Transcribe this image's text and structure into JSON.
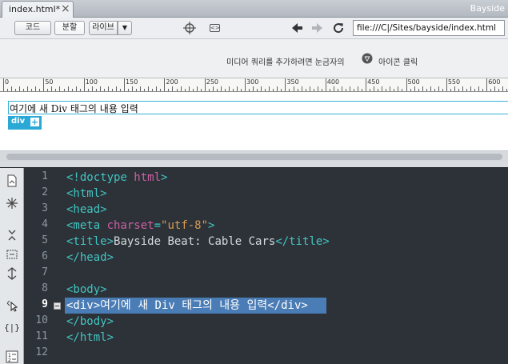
{
  "tab": {
    "title": "index.html*",
    "close": "×",
    "site": "Bayside"
  },
  "toolbar": {
    "code_label": "코드",
    "split_label": "분할",
    "live_label": "라이브",
    "live_dropdown": "▼",
    "address": "file:///C|/Sites/bayside/index.html"
  },
  "media_query_bar": {
    "text": "미디어 쿼리를 추가하려면 눈금자의",
    "text2": "아이콘 클릭"
  },
  "ruler": {
    "labels": [
      "0",
      "50",
      "100",
      "150",
      "200",
      "250",
      "300",
      "350",
      "400",
      "450",
      "500",
      "550",
      "600"
    ]
  },
  "design_view": {
    "content_text": "여기에 새 Div 태그의 내용 입력",
    "element_badge": "div",
    "add_button": "+"
  },
  "code_view": {
    "line_numbers": [
      "1",
      "2",
      "3",
      "4",
      "5",
      "6",
      "7",
      "8",
      "9",
      "10",
      "11",
      "12"
    ],
    "active_line": "9",
    "lines": [
      {
        "tokens": [
          [
            "tag",
            "<!doctype "
          ],
          [
            "kw",
            "html"
          ],
          [
            "tag",
            ">"
          ]
        ]
      },
      {
        "tokens": [
          [
            "tag",
            "<html>"
          ]
        ]
      },
      {
        "tokens": [
          [
            "tag",
            "<head>"
          ]
        ]
      },
      {
        "tokens": [
          [
            "tag",
            "<meta "
          ],
          [
            "kw",
            "charset"
          ],
          [
            "tag",
            "="
          ],
          [
            "val",
            "\"utf-8\""
          ],
          [
            "tag",
            ">"
          ]
        ]
      },
      {
        "tokens": [
          [
            "tag",
            "<title>"
          ],
          [
            "txt",
            "Bayside Beat: Cable Cars"
          ],
          [
            "tag",
            "</title>"
          ]
        ]
      },
      {
        "tokens": [
          [
            "tag",
            "</head>"
          ]
        ]
      },
      {
        "tokens": []
      },
      {
        "tokens": [
          [
            "tag",
            "<body>"
          ]
        ]
      },
      {
        "tokens": [
          [
            "sel",
            "<div>여기에 새 Div 태그의 내용 입력</div>"
          ]
        ]
      },
      {
        "tokens": [
          [
            "tag",
            "</body>"
          ]
        ]
      },
      {
        "tokens": [
          [
            "tag",
            "</html>"
          ]
        ]
      },
      {
        "tokens": []
      }
    ]
  },
  "icons": {
    "target": "target-icon",
    "inspect": "inspect-icon",
    "back": "back-arrow-icon",
    "forward": "forward-arrow-icon",
    "refresh": "refresh-icon",
    "media_query": "media-query-icon"
  },
  "colors": {
    "selection": "#4a7cb5",
    "tag": "#43c4c2",
    "keyword": "#ce5fa3",
    "string": "#d79b4f",
    "code_bg": "#2c3238",
    "div_accent": "#2aa9d6"
  }
}
